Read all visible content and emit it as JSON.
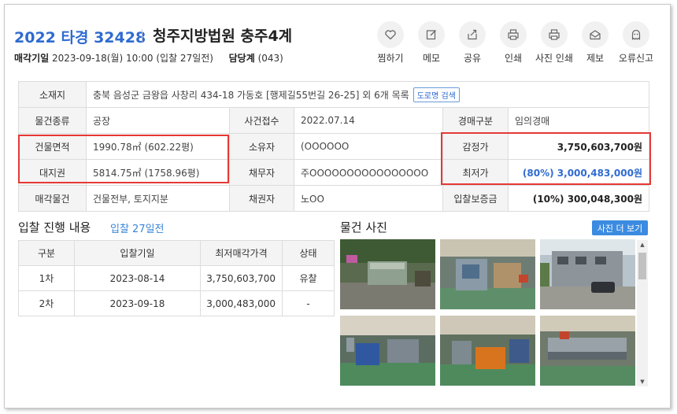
{
  "header": {
    "case_number": "2022 타경 32428",
    "court": "청주지방법원 충주4계",
    "sale_date_label": "매각기일",
    "sale_date_value": "2023-09-18(월) 10:00 (입찰 27일전)",
    "dept_label": "담당계",
    "dept_value": "(043)"
  },
  "actions": [
    {
      "label": "찜하기",
      "icon": "heart-icon"
    },
    {
      "label": "메모",
      "icon": "edit-icon"
    },
    {
      "label": "공유",
      "icon": "share-icon"
    },
    {
      "label": "인쇄",
      "icon": "print-icon"
    },
    {
      "label": "사진 인쇄",
      "icon": "photo-print-icon"
    },
    {
      "label": "제보",
      "icon": "mail-icon"
    },
    {
      "label": "오류신고",
      "icon": "ghost-icon"
    }
  ],
  "info": {
    "address_label": "소재지",
    "address_value": "충북 음성군 금왕읍 사창리 434-18 가동호 [행제길55번길 26-25] 외 6개 목록",
    "road_search": "도로명 검색",
    "type_label": "물건종류",
    "type_value": "공장",
    "received_label": "사건접수",
    "received_value": "2022.07.14",
    "auction_type_label": "경매구분",
    "auction_type_value": "임의경매",
    "building_area_label": "건물면적",
    "building_area_value": "1990.78㎡ (602.22평)",
    "owner_label": "소유자",
    "owner_value": "(OOOOOO",
    "appraisal_label": "감정가",
    "appraisal_value": "3,750,603,700원",
    "land_label": "대지권",
    "land_value": "5814.75㎡ (1758.96평)",
    "debtor_label": "채무자",
    "debtor_value": "주OOOOOOOOOOOOOOOO",
    "minimum_label": "최저가",
    "minimum_value": "(80%) 3,000,483,000원",
    "sale_item_label": "매각물건",
    "sale_item_value": "건물전부, 토지지분",
    "creditor_label": "채권자",
    "creditor_value": "노OO",
    "deposit_label": "입찰보증금",
    "deposit_value": "(10%) 300,048,300원"
  },
  "bid": {
    "title": "입찰 진행 내용",
    "subtitle": "입찰 27일전",
    "headers": [
      "구분",
      "입찰기일",
      "최저매각가격",
      "상태"
    ],
    "rows": [
      {
        "round": "1차",
        "date": "2023-08-14",
        "price": "3,750,603,700",
        "status": "유찰"
      },
      {
        "round": "2차",
        "date": "2023-09-18",
        "price": "3,000,483,000",
        "status": "-"
      }
    ]
  },
  "photos": {
    "title": "물건 사진",
    "more_button": "사진 더 보기",
    "items": [
      "photo-1",
      "photo-2",
      "photo-3",
      "photo-4",
      "photo-5",
      "photo-6"
    ]
  },
  "colors": {
    "accent_blue": "#2f6bd0",
    "highlight_red": "#e53935",
    "button_blue": "#3b8be0"
  }
}
